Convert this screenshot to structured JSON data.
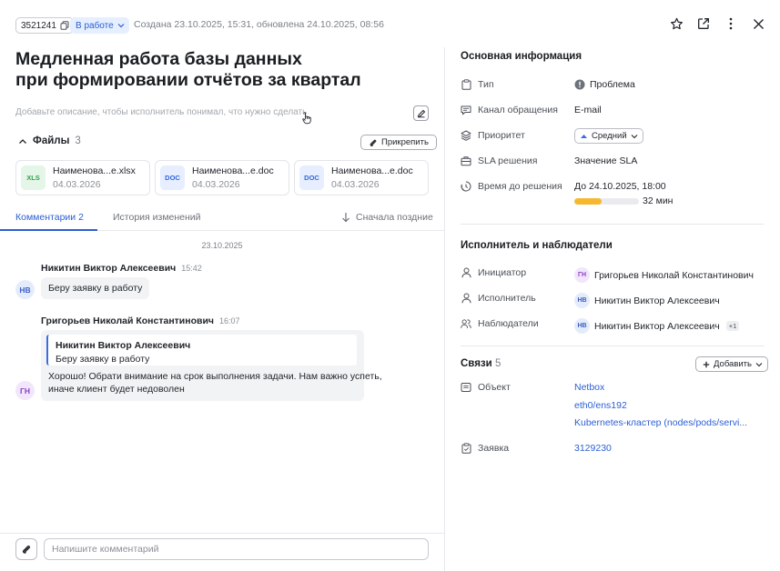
{
  "header": {
    "ticket_id": "3521241",
    "status": "В работе",
    "meta": "Создана 23.10.2025, 15:31, обновлена 24.10.2025, 08:56"
  },
  "ticket": {
    "title_line1": "Медленная работа базы данных",
    "title_line2": "при формировании отчётов за квартал",
    "description_placeholder": "Добавьте описание, чтобы исполнитель понимал, что нужно сделать"
  },
  "files": {
    "label": "Файлы",
    "count": "3",
    "attach_label": "Прикрепить",
    "items": [
      {
        "type": "XLS",
        "name": "Наименова...e.xlsx",
        "date": "04.03.2026"
      },
      {
        "type": "DOC",
        "name": "Наименова...e.doc",
        "date": "04.03.2026"
      },
      {
        "type": "DOC",
        "name": "Наименова...e.doc",
        "date": "04.03.2026"
      }
    ]
  },
  "tabs": {
    "comments_label": "Комментарии",
    "comments_count": "2",
    "history_label": "История изменений",
    "sort_label": "Сначала поздние"
  },
  "comments": {
    "date": "23.10.2025",
    "items": [
      {
        "author": "Никитин Виктор Алексеевич",
        "time": "15:42",
        "initials": "НВ",
        "text": "Беру заявку в работу"
      },
      {
        "author": "Григорьев Николай Константинович",
        "time": "16:07",
        "initials": "ГН",
        "quote_author": "Никитин Виктор Алексеевич",
        "quote_text": "Беру заявку в работу",
        "text_line1": "Хорошо! Обрати внимание на срок выполнения задачи. Нам важно успеть,",
        "text_line2": "иначе клиент будет недоволен"
      }
    ]
  },
  "composer": {
    "placeholder": "Напишите комментарий"
  },
  "info": {
    "title": "Основная информация",
    "type_label": "Тип",
    "type_value": "Проблема",
    "channel_label": "Канал обращения",
    "channel_value": "E-mail",
    "priority_label": "Приоритет",
    "priority_value": "Средний",
    "sla_label": "SLA решения",
    "sla_value": "Значение SLA",
    "deadline_label": "Время до решения",
    "deadline_value": "До 24.10.2025, 18:00",
    "remaining": "32 мин",
    "progress_fraction": 0.42
  },
  "people": {
    "title": "Исполнитель и наблюдатели",
    "initiator_label": "Инициатор",
    "initiator_initials": "ГН",
    "initiator_name": "Григорьев Николай Константинович",
    "assignee_label": "Исполнитель",
    "assignee_initials": "НВ",
    "assignee_name": "Никитин Виктор Алексеевич",
    "watchers_label": "Наблюдатели",
    "watchers_initials": "НВ",
    "watchers_name": "Никитин Виктор Алексеевич",
    "watchers_more": "+1"
  },
  "links": {
    "title": "Связи",
    "count": "5",
    "add_label": "Добавить",
    "object_label": "Объект",
    "objects": [
      "Netbox",
      "eth0/ens192",
      "Kubernetes-кластер (nodes/pods/servi..."
    ],
    "request_label": "Заявка",
    "request_value": "3129230"
  },
  "colors": {
    "accent": "#2c5fd3",
    "progress": "#f5b82e",
    "status_bg": "#e5efff"
  }
}
